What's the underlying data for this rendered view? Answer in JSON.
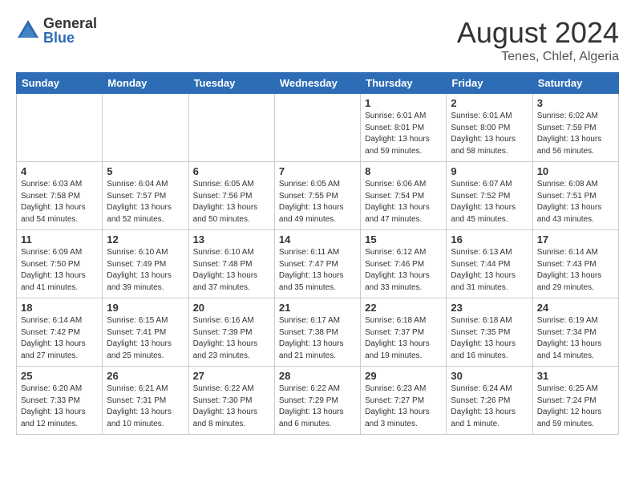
{
  "header": {
    "logo_general": "General",
    "logo_blue": "Blue",
    "month_year": "August 2024",
    "location": "Tenes, Chlef, Algeria"
  },
  "weekdays": [
    "Sunday",
    "Monday",
    "Tuesday",
    "Wednesday",
    "Thursday",
    "Friday",
    "Saturday"
  ],
  "weeks": [
    [
      {
        "day": "",
        "sunrise": "",
        "sunset": "",
        "daylight": "",
        "empty": true
      },
      {
        "day": "",
        "sunrise": "",
        "sunset": "",
        "daylight": "",
        "empty": true
      },
      {
        "day": "",
        "sunrise": "",
        "sunset": "",
        "daylight": "",
        "empty": true
      },
      {
        "day": "",
        "sunrise": "",
        "sunset": "",
        "daylight": "",
        "empty": true
      },
      {
        "day": "1",
        "sunrise": "Sunrise: 6:01 AM",
        "sunset": "Sunset: 8:01 PM",
        "daylight": "Daylight: 13 hours and 59 minutes.",
        "empty": false
      },
      {
        "day": "2",
        "sunrise": "Sunrise: 6:01 AM",
        "sunset": "Sunset: 8:00 PM",
        "daylight": "Daylight: 13 hours and 58 minutes.",
        "empty": false
      },
      {
        "day": "3",
        "sunrise": "Sunrise: 6:02 AM",
        "sunset": "Sunset: 7:59 PM",
        "daylight": "Daylight: 13 hours and 56 minutes.",
        "empty": false
      }
    ],
    [
      {
        "day": "4",
        "sunrise": "Sunrise: 6:03 AM",
        "sunset": "Sunset: 7:58 PM",
        "daylight": "Daylight: 13 hours and 54 minutes.",
        "empty": false
      },
      {
        "day": "5",
        "sunrise": "Sunrise: 6:04 AM",
        "sunset": "Sunset: 7:57 PM",
        "daylight": "Daylight: 13 hours and 52 minutes.",
        "empty": false
      },
      {
        "day": "6",
        "sunrise": "Sunrise: 6:05 AM",
        "sunset": "Sunset: 7:56 PM",
        "daylight": "Daylight: 13 hours and 50 minutes.",
        "empty": false
      },
      {
        "day": "7",
        "sunrise": "Sunrise: 6:05 AM",
        "sunset": "Sunset: 7:55 PM",
        "daylight": "Daylight: 13 hours and 49 minutes.",
        "empty": false
      },
      {
        "day": "8",
        "sunrise": "Sunrise: 6:06 AM",
        "sunset": "Sunset: 7:54 PM",
        "daylight": "Daylight: 13 hours and 47 minutes.",
        "empty": false
      },
      {
        "day": "9",
        "sunrise": "Sunrise: 6:07 AM",
        "sunset": "Sunset: 7:52 PM",
        "daylight": "Daylight: 13 hours and 45 minutes.",
        "empty": false
      },
      {
        "day": "10",
        "sunrise": "Sunrise: 6:08 AM",
        "sunset": "Sunset: 7:51 PM",
        "daylight": "Daylight: 13 hours and 43 minutes.",
        "empty": false
      }
    ],
    [
      {
        "day": "11",
        "sunrise": "Sunrise: 6:09 AM",
        "sunset": "Sunset: 7:50 PM",
        "daylight": "Daylight: 13 hours and 41 minutes.",
        "empty": false
      },
      {
        "day": "12",
        "sunrise": "Sunrise: 6:10 AM",
        "sunset": "Sunset: 7:49 PM",
        "daylight": "Daylight: 13 hours and 39 minutes.",
        "empty": false
      },
      {
        "day": "13",
        "sunrise": "Sunrise: 6:10 AM",
        "sunset": "Sunset: 7:48 PM",
        "daylight": "Daylight: 13 hours and 37 minutes.",
        "empty": false
      },
      {
        "day": "14",
        "sunrise": "Sunrise: 6:11 AM",
        "sunset": "Sunset: 7:47 PM",
        "daylight": "Daylight: 13 hours and 35 minutes.",
        "empty": false
      },
      {
        "day": "15",
        "sunrise": "Sunrise: 6:12 AM",
        "sunset": "Sunset: 7:46 PM",
        "daylight": "Daylight: 13 hours and 33 minutes.",
        "empty": false
      },
      {
        "day": "16",
        "sunrise": "Sunrise: 6:13 AM",
        "sunset": "Sunset: 7:44 PM",
        "daylight": "Daylight: 13 hours and 31 minutes.",
        "empty": false
      },
      {
        "day": "17",
        "sunrise": "Sunrise: 6:14 AM",
        "sunset": "Sunset: 7:43 PM",
        "daylight": "Daylight: 13 hours and 29 minutes.",
        "empty": false
      }
    ],
    [
      {
        "day": "18",
        "sunrise": "Sunrise: 6:14 AM",
        "sunset": "Sunset: 7:42 PM",
        "daylight": "Daylight: 13 hours and 27 minutes.",
        "empty": false
      },
      {
        "day": "19",
        "sunrise": "Sunrise: 6:15 AM",
        "sunset": "Sunset: 7:41 PM",
        "daylight": "Daylight: 13 hours and 25 minutes.",
        "empty": false
      },
      {
        "day": "20",
        "sunrise": "Sunrise: 6:16 AM",
        "sunset": "Sunset: 7:39 PM",
        "daylight": "Daylight: 13 hours and 23 minutes.",
        "empty": false
      },
      {
        "day": "21",
        "sunrise": "Sunrise: 6:17 AM",
        "sunset": "Sunset: 7:38 PM",
        "daylight": "Daylight: 13 hours and 21 minutes.",
        "empty": false
      },
      {
        "day": "22",
        "sunrise": "Sunrise: 6:18 AM",
        "sunset": "Sunset: 7:37 PM",
        "daylight": "Daylight: 13 hours and 19 minutes.",
        "empty": false
      },
      {
        "day": "23",
        "sunrise": "Sunrise: 6:18 AM",
        "sunset": "Sunset: 7:35 PM",
        "daylight": "Daylight: 13 hours and 16 minutes.",
        "empty": false
      },
      {
        "day": "24",
        "sunrise": "Sunrise: 6:19 AM",
        "sunset": "Sunset: 7:34 PM",
        "daylight": "Daylight: 13 hours and 14 minutes.",
        "empty": false
      }
    ],
    [
      {
        "day": "25",
        "sunrise": "Sunrise: 6:20 AM",
        "sunset": "Sunset: 7:33 PM",
        "daylight": "Daylight: 13 hours and 12 minutes.",
        "empty": false
      },
      {
        "day": "26",
        "sunrise": "Sunrise: 6:21 AM",
        "sunset": "Sunset: 7:31 PM",
        "daylight": "Daylight: 13 hours and 10 minutes.",
        "empty": false
      },
      {
        "day": "27",
        "sunrise": "Sunrise: 6:22 AM",
        "sunset": "Sunset: 7:30 PM",
        "daylight": "Daylight: 13 hours and 8 minutes.",
        "empty": false
      },
      {
        "day": "28",
        "sunrise": "Sunrise: 6:22 AM",
        "sunset": "Sunset: 7:29 PM",
        "daylight": "Daylight: 13 hours and 6 minutes.",
        "empty": false
      },
      {
        "day": "29",
        "sunrise": "Sunrise: 6:23 AM",
        "sunset": "Sunset: 7:27 PM",
        "daylight": "Daylight: 13 hours and 3 minutes.",
        "empty": false
      },
      {
        "day": "30",
        "sunrise": "Sunrise: 6:24 AM",
        "sunset": "Sunset: 7:26 PM",
        "daylight": "Daylight: 13 hours and 1 minute.",
        "empty": false
      },
      {
        "day": "31",
        "sunrise": "Sunrise: 6:25 AM",
        "sunset": "Sunset: 7:24 PM",
        "daylight": "Daylight: 12 hours and 59 minutes.",
        "empty": false
      }
    ]
  ]
}
